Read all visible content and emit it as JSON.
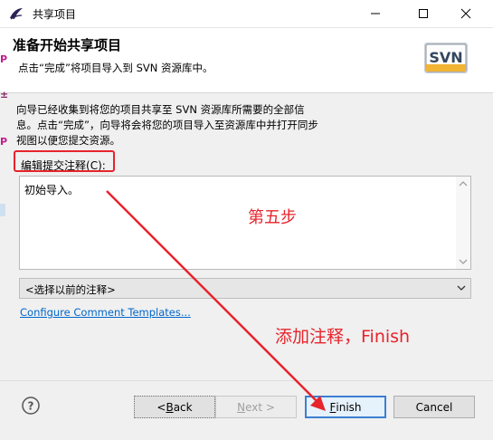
{
  "window": {
    "title": "共享项目",
    "controls": {
      "minimize": "minimize-icon",
      "maximize": "maximize-icon",
      "close": "close-icon"
    }
  },
  "header": {
    "title": "准备开始共享项目",
    "subtitle": "点击“完成”将项目导入到 SVN 资源库中。",
    "logo_text": "SVN"
  },
  "body": {
    "description_lines": [
      "向导已经收集到将您的项目共享至 SVN 资源库所需要的全部信",
      "息。点击“完成”，向导将会将您的项目导入至资源库中并打开同步",
      "视图以便您提交资源。"
    ],
    "comment_label_prefix": "编辑提交注释(",
    "comment_label_mnemonic": "C",
    "comment_label_suffix": "):",
    "comment_text": "初始导入。",
    "previous_comments_selected": "<选择以前的注释>",
    "configure_link": "Configure Comment Templates..."
  },
  "buttons": {
    "back_prefix": "< ",
    "back_mnemonic": "B",
    "back_rest": "ack",
    "next_mnemonic": "N",
    "next_rest": "ext >",
    "finish_mnemonic": "F",
    "finish_rest": "inish",
    "cancel": "Cancel"
  },
  "annotations": {
    "step": "第五步",
    "note": "添加注释，Finish",
    "color": "#e8232b"
  },
  "colors": {
    "accent": "#3c7fd1",
    "link": "#0066cc"
  }
}
